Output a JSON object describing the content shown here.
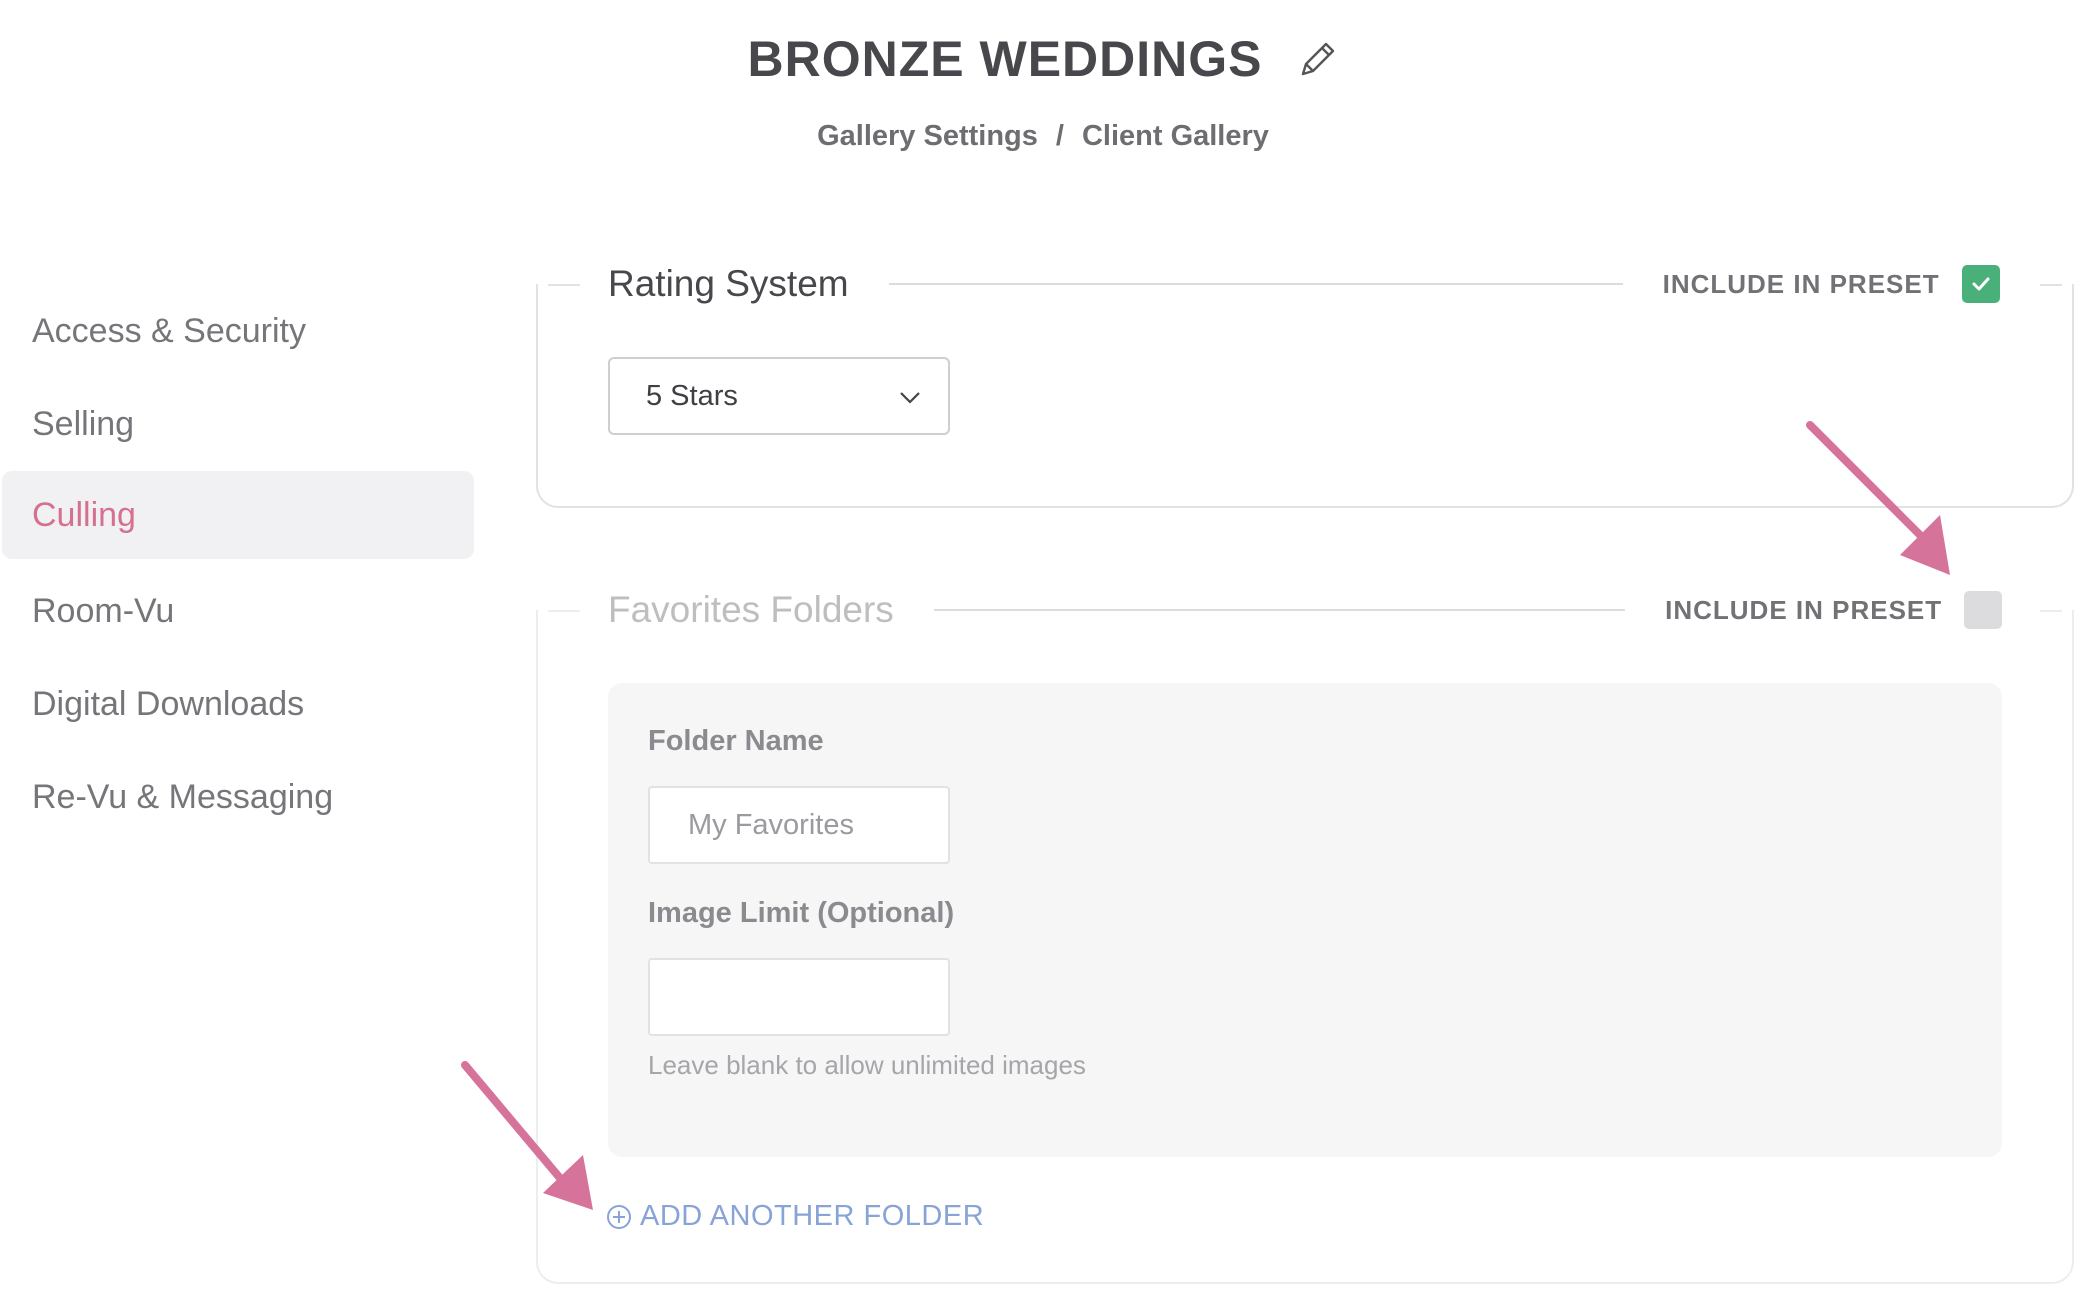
{
  "header": {
    "title": "BRONZE WEDDINGS",
    "breadcrumb": [
      {
        "label": "Gallery Settings"
      },
      {
        "label": "Client Gallery"
      }
    ],
    "breadcrumb_separator": "/"
  },
  "sidebar": {
    "items": [
      {
        "label": "Access & Security"
      },
      {
        "label": "Selling"
      },
      {
        "label": "Culling",
        "active": true
      },
      {
        "label": "Room-Vu"
      },
      {
        "label": "Digital Downloads"
      },
      {
        "label": "Re-Vu & Messaging"
      }
    ]
  },
  "rating_system": {
    "title": "Rating System",
    "include_in_preset_label": "INCLUDE IN PRESET",
    "include_in_preset_checked": true,
    "select_value": "5 Stars"
  },
  "favorites_folders": {
    "title": "Favorites Folders",
    "include_in_preset_label": "INCLUDE IN PRESET",
    "include_in_preset_checked": false,
    "folder_name_label": "Folder Name",
    "folder_name_placeholder": "My Favorites",
    "image_limit_label": "Image Limit (Optional)",
    "image_limit_value": "",
    "image_limit_hint": "Leave blank to allow unlimited images",
    "add_folder_label": "ADD ANOTHER FOLDER"
  },
  "colors": {
    "accent_pink": "#d6708f",
    "check_green": "#4ab07a",
    "link_blue": "#88a3d6",
    "annotation_arrow": "#d6739a"
  },
  "icons": {
    "title_edit": "pencil-icon",
    "select": "chevron-down-icon",
    "checked": "checkmark-icon",
    "add": "plus-circle-icon",
    "annotation": "arrow-icon"
  }
}
